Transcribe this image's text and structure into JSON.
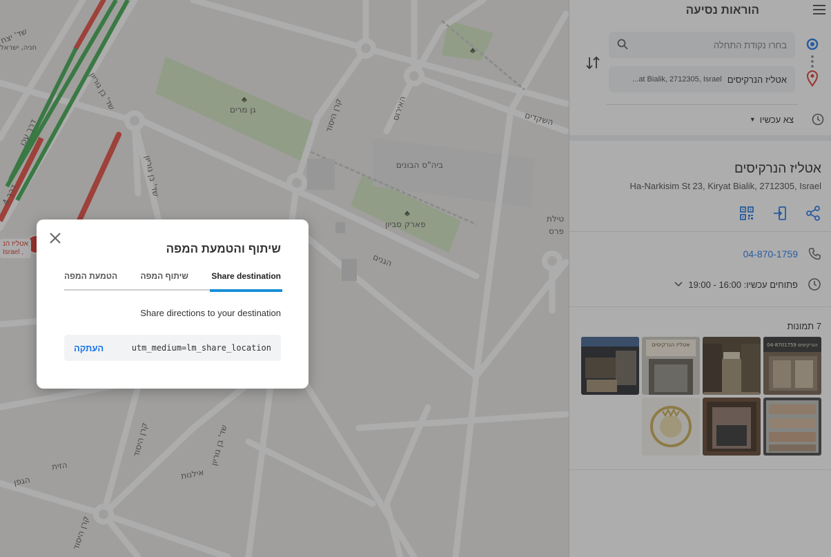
{
  "map": {
    "labels": {
      "gan_miriam": "גן מרים",
      "kiryat_hasofer": "קרן היסוד",
      "school": "ביה\"ס הבונים",
      "park": "פארק סביון",
      "ha_ardim": "האירוס",
      "ha_shkedim": "השקדים",
      "ben_gurion1": "שד' בן גוריון",
      "ben_gurion2": "שד' בן גוריון",
      "ha_ganim": "הגנים",
      "keren_hayesod2": "קרן היסוד",
      "ben_gurion3": "שד' בן גוריון",
      "ilanot": "אילנות",
      "hazayit": "הזית",
      "hagefen": "הגפן",
      "keren_hayesod3": "קרן היסוד",
      "yitzhak": "שד' יצח",
      "hanira": "חניה, ישראל",
      "road_4": "דרך 4",
      "derech_haifa": "דרך עכו",
      "tilat": "טילת",
      "perses": "פרס"
    },
    "marker": {
      "label_line1": "אטליז הנ",
      "label_line2": "Israel ,"
    }
  },
  "sidebar": {
    "title": "הוראות נסיעה",
    "start_placeholder": "בחרו נקודת התחלה",
    "end_name": "אטליז הנרקיסים",
    "end_address": "at Bialik, 2712305, Israel...",
    "depart_label": "צא עכשיו",
    "place": {
      "name": "אטליז הנרקיסים",
      "address": "Ha-Narkisim St 23, Kiryat Bialik, 2712305, Israel",
      "phone": "04-870-1759",
      "hours": "פתוחים עכשיו: 16:00 - 19:00",
      "photos_title": "7 תמונות",
      "photo_sign_1": "אטליז הנרקיסים",
      "photo_sign_2": "הנרקיסים 04-8701759"
    }
  },
  "modal": {
    "title": "שיתוף והטמעת המפה",
    "tabs": [
      "Share destination",
      "שיתוף המפה",
      "הטמעת המפה"
    ],
    "description": "Share directions to your destination",
    "link_value": "utm_medium=lm_share_location",
    "copy_label": "העתקה"
  },
  "colors": {
    "accent": "#1a8fd6",
    "link": "#1a73e8",
    "park": "#b9dc9a",
    "traffic_green": "#3aa64a",
    "traffic_red": "#e3453a",
    "marker_red": "#d93025"
  },
  "icons": {
    "menu": "menu-icon",
    "search": "search-icon",
    "swap": "swap-icon",
    "clock": "clock-icon",
    "qr": "qr-code-icon",
    "directions": "directions-icon",
    "share": "share-icon",
    "phone": "phone-icon",
    "close": "close-icon"
  }
}
